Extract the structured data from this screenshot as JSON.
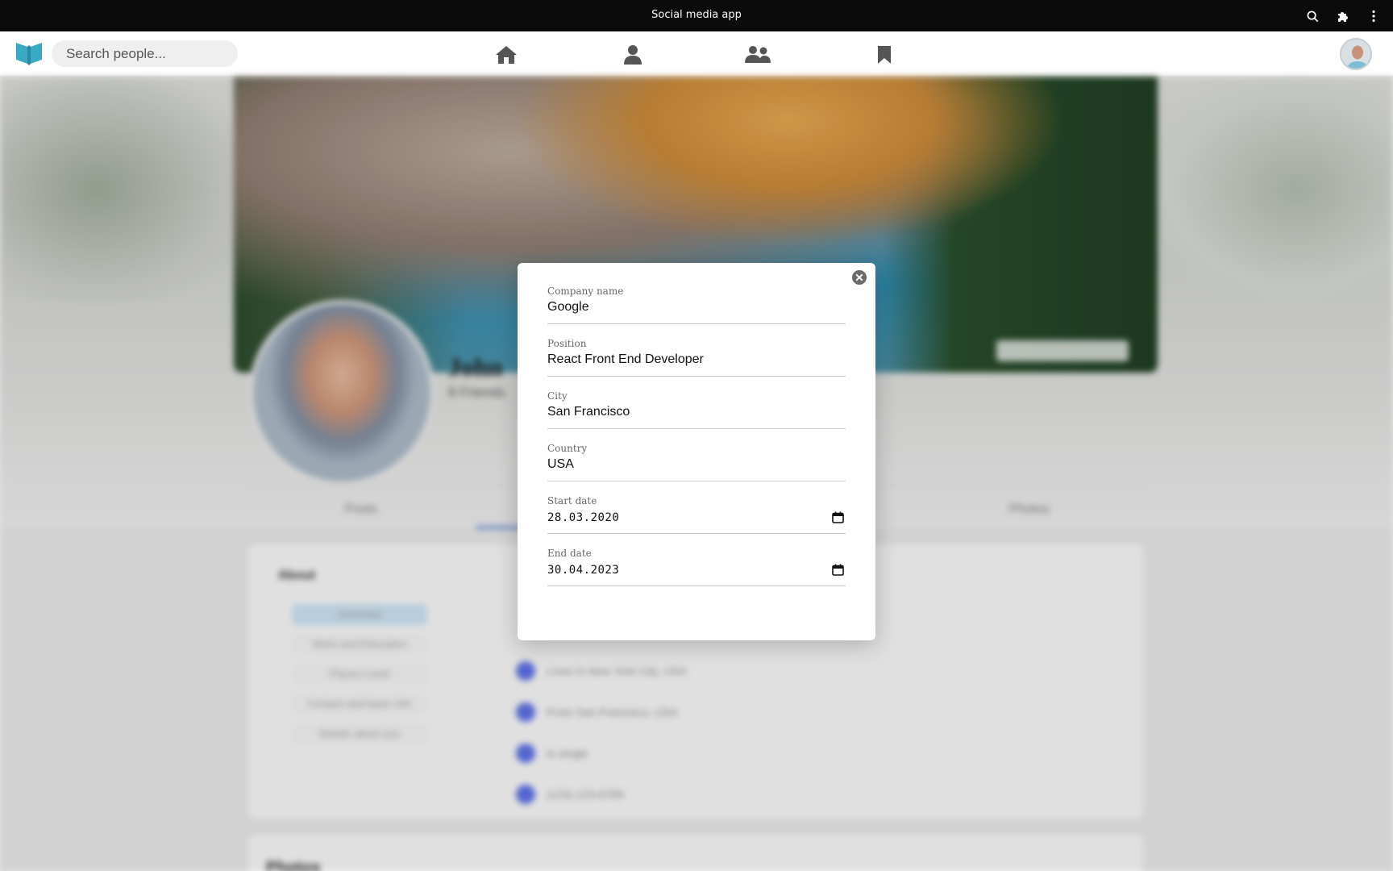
{
  "window": {
    "title": "Social media app"
  },
  "header": {
    "search_placeholder": "Search people..."
  },
  "background_page": {
    "name": "John",
    "friends": "8 Friends",
    "tabs": [
      "Posts",
      "Photos"
    ],
    "about_title": "About",
    "about_items": [
      "Overview",
      "Work and Education",
      "Places Lived",
      "Contact and basic info",
      "Details about you"
    ],
    "about_rows": [
      "Lives in New York City, USA",
      "From San Francisco, USA",
      "Is single",
      "(123) 123-6789"
    ],
    "photos_title": "Photos"
  },
  "modal": {
    "fields": [
      {
        "label": "Company name",
        "value": "Google"
      },
      {
        "label": "Position",
        "value": "React Front End Developer"
      },
      {
        "label": "City",
        "value": "San Francisco"
      },
      {
        "label": "Country",
        "value": "USA"
      }
    ],
    "start_date": {
      "label": "Start date",
      "value": "28.03.2020"
    },
    "end_date": {
      "label": "End date",
      "value": "30.04.2023"
    }
  },
  "colors": {
    "titlebar": "#0b0b0b",
    "logo": "#3aa9c4",
    "nav_icon": "#555555",
    "overlay": "#e4e4e4"
  },
  "icons": [
    "search-icon",
    "extension-icon",
    "more-vertical-icon",
    "home-icon",
    "profile-icon",
    "friends-icon",
    "bookmark-icon",
    "close-icon",
    "calendar-icon"
  ]
}
